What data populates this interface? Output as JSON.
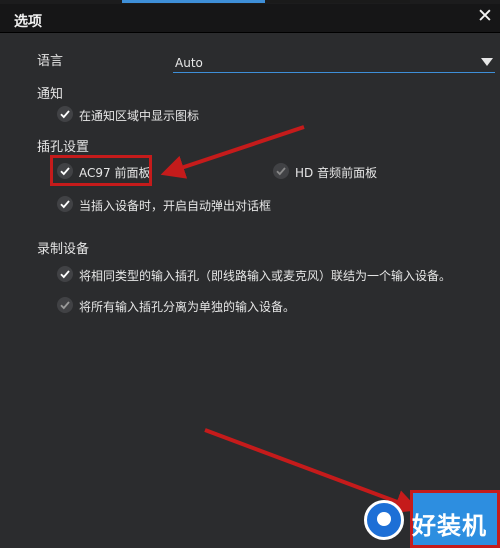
{
  "dialog": {
    "title": "选项",
    "close_label": "✕"
  },
  "language": {
    "label": "语言",
    "value": "Auto"
  },
  "notify": {
    "heading": "通知",
    "show_tray_icon": "在通知区域中显示图标"
  },
  "jack": {
    "heading": "插孔设置",
    "ac97_front_panel": "AC97 前面板",
    "hd_front_panel": "HD 音频前面板",
    "auto_popup": "当插入设备时，开启自动弹出对话框"
  },
  "record": {
    "heading": "录制设备",
    "merge_inputs": "将相同类型的输入插孔（即线路输入或麦克风）联结为一个输入设备。",
    "separate_inputs": "将所有输入插孔分离为单独的输入设备。"
  },
  "watermark": {
    "text": "好装机"
  },
  "colors": {
    "accent": "#3e8fd8",
    "background": "#2b2c2e",
    "titlebar": "#161617",
    "annotation_red": "#c51b1b"
  }
}
